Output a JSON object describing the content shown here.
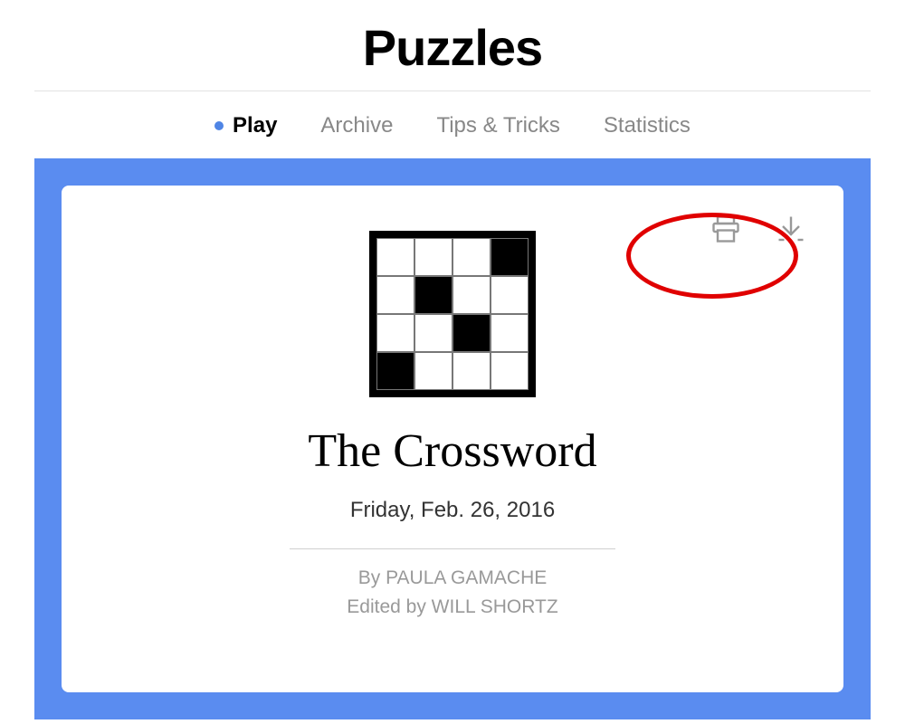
{
  "header": {
    "site_title": "Puzzles"
  },
  "nav": {
    "items": [
      {
        "label": "Play",
        "active": true
      },
      {
        "label": "Archive",
        "active": false
      },
      {
        "label": "Tips & Tricks",
        "active": false
      },
      {
        "label": "Statistics",
        "active": false
      }
    ]
  },
  "actions": {
    "print": "print-icon",
    "download": "download-icon"
  },
  "puzzle": {
    "title": "The Crossword",
    "date": "Friday, Feb. 26, 2016",
    "byline": "By PAULA GAMACHE",
    "edited_by": "Edited by WILL SHORTZ"
  },
  "colors": {
    "accent": "#5a8cf0",
    "annotation": "#e00000"
  }
}
